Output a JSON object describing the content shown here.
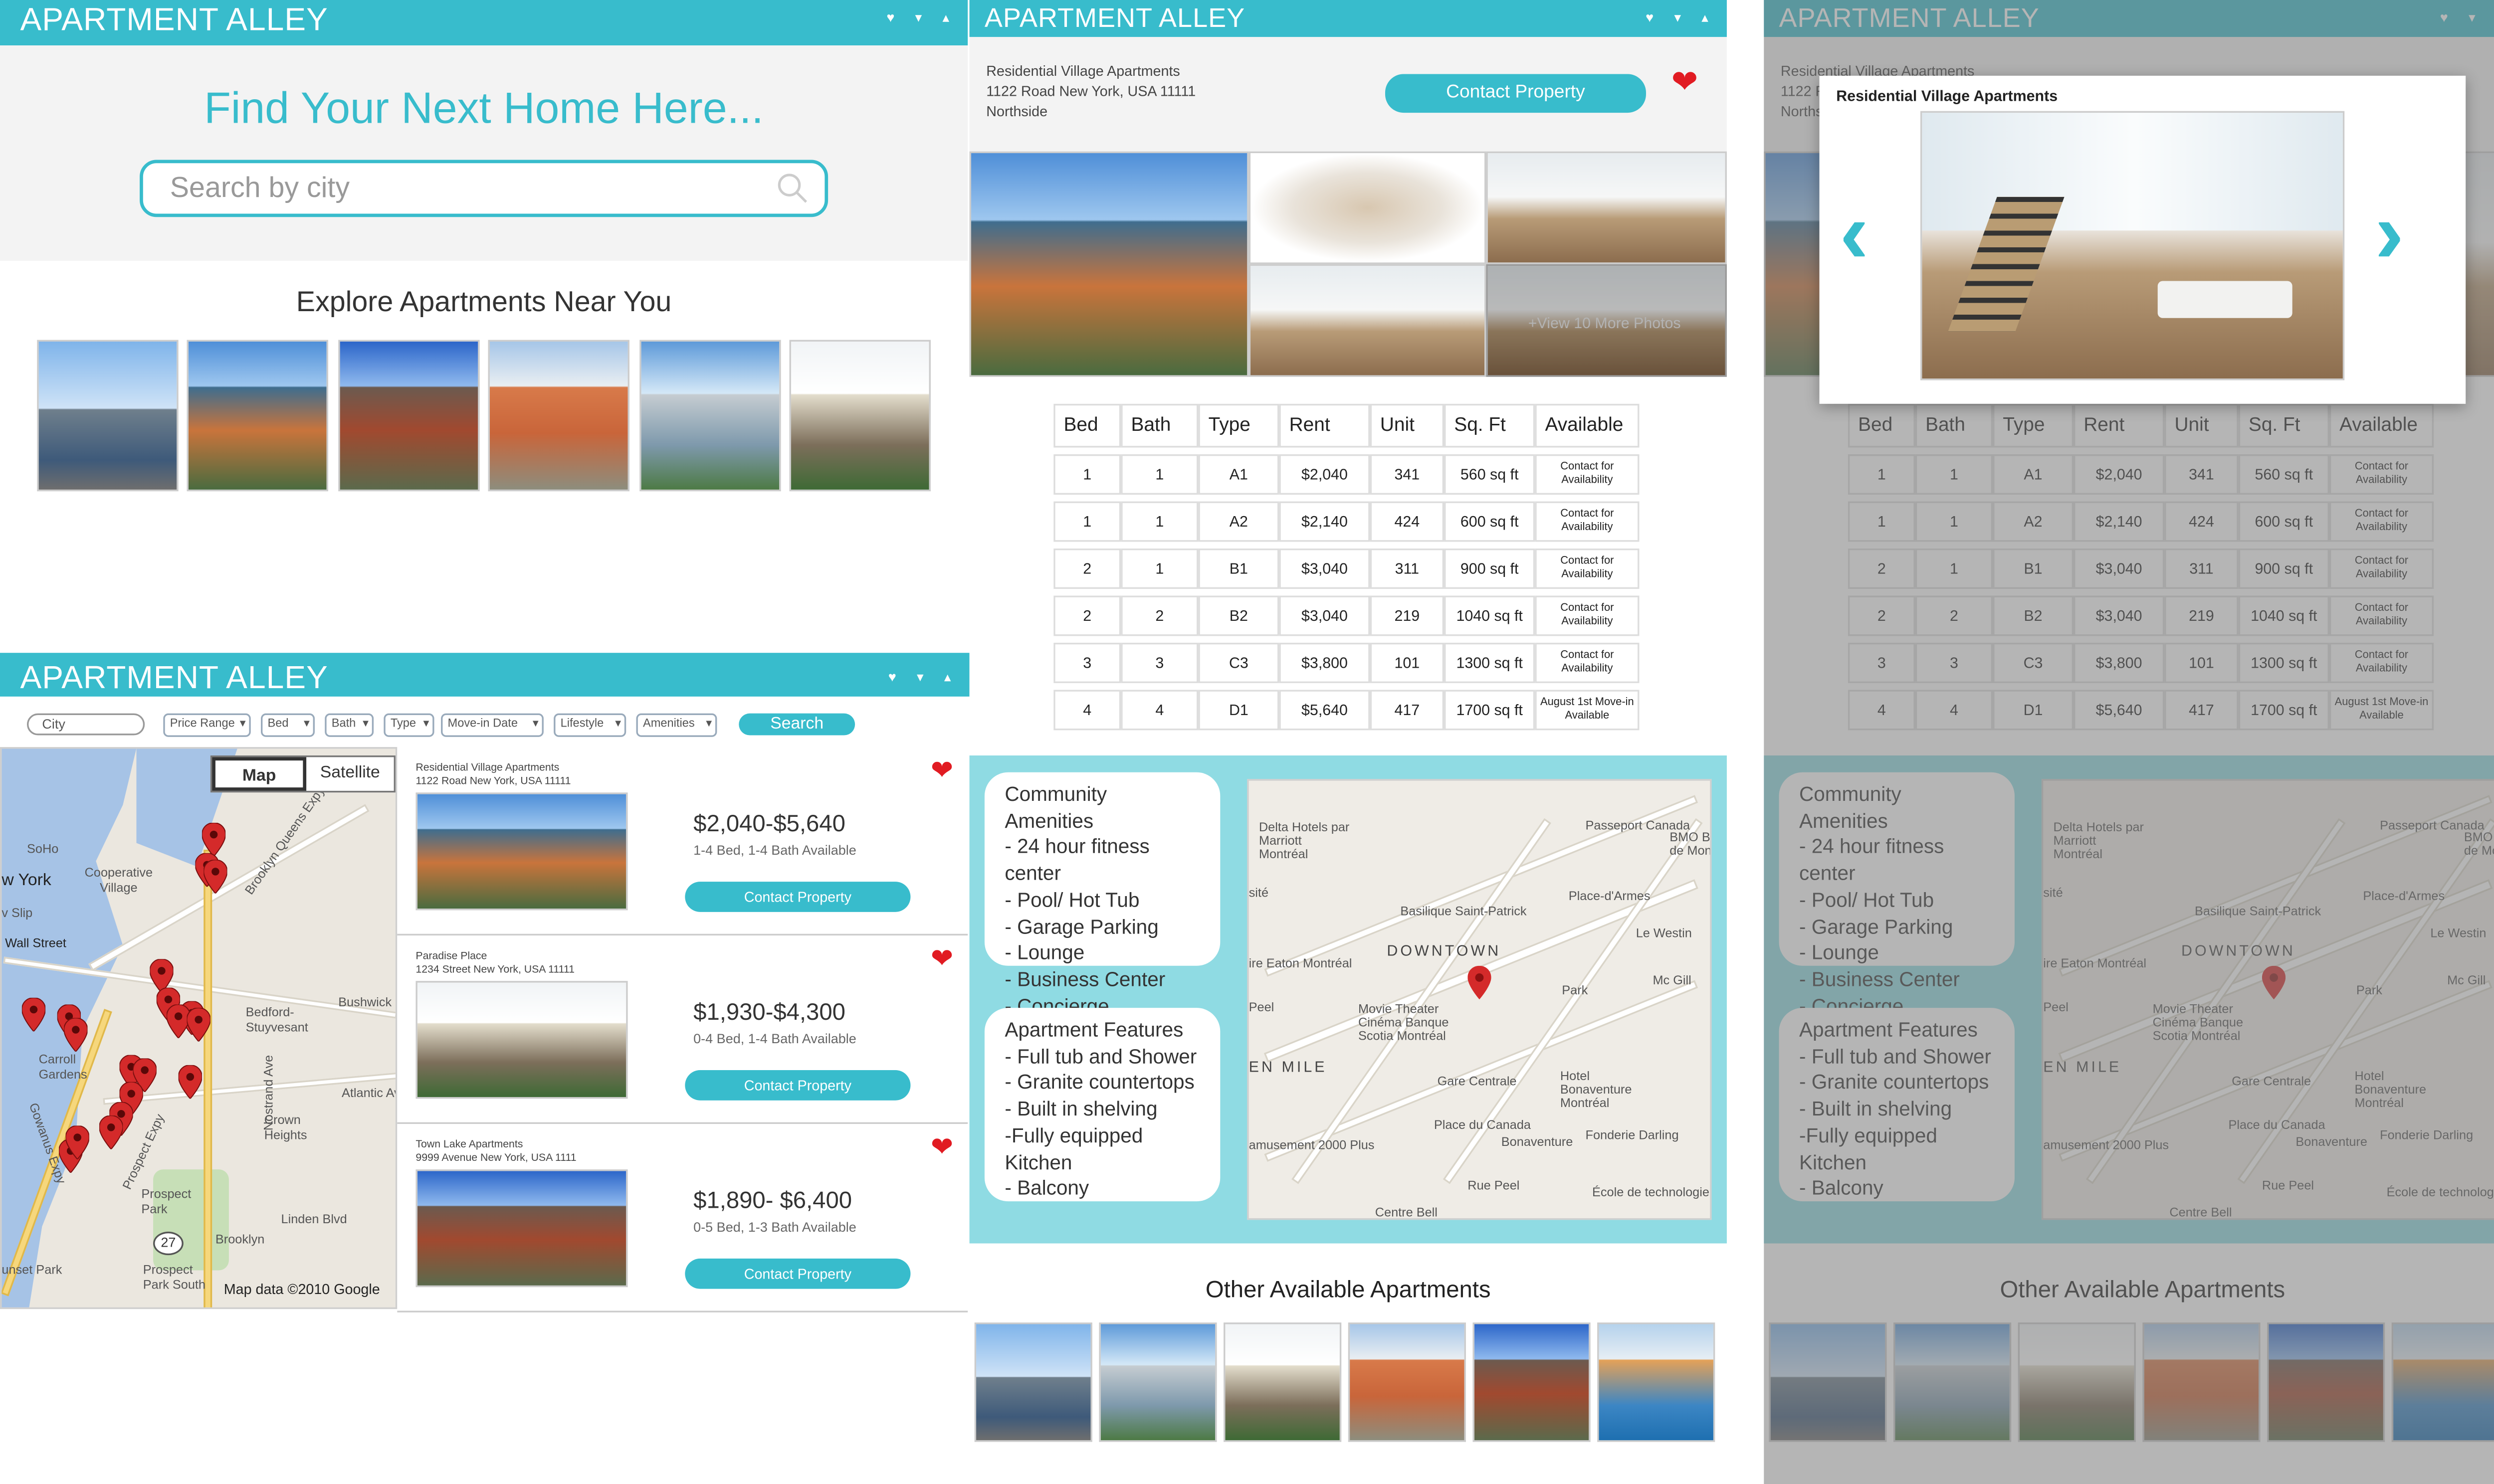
{
  "app_title": "APARTMENT ALLEY",
  "window_controls": "♥ ▾ ▴",
  "home": {
    "headline": "Find Your Next Home Here...",
    "search_placeholder": "Search by city",
    "explore_title": "Explore Apartments Near You"
  },
  "search_screen": {
    "filters": {
      "city_placeholder": "City",
      "price_range": "Price Range",
      "bed": "Bed",
      "bath": "Bath",
      "type": "Type",
      "move_in": "Move-in Date",
      "lifestyle": "Lifestyle",
      "amenities": "Amenities",
      "search_button": "Search"
    },
    "map": {
      "map_tab": "Map",
      "satellite_tab": "Satellite",
      "attribution": "Map data ©2010 Google",
      "labels": [
        "SoHo",
        "w York",
        "Cooperative Village",
        "Wall Street",
        "v Slip",
        "Carroll Gardens",
        "Bedford-Stuyvesant",
        "Bushwick",
        "Crown Heights",
        "Prospect Park",
        "Linden Blvd",
        "Brooklyn",
        "Prospect Park South",
        "unset Park",
        "Atlantic Av",
        "Nostrand Ave",
        "Brooklyn Queens Expy",
        "Prospect Expy",
        "Gowanus Expy",
        "27"
      ]
    },
    "listings": [
      {
        "name": "Residential Village Apartments",
        "address": "1122 Road New York, USA 11111",
        "price": "$2,040-$5,640",
        "details": "1-4 Bed, 1-4 Bath Available",
        "button": "Contact Property"
      },
      {
        "name": "Paradise Place",
        "address": "1234 Street New York, USA 11111",
        "price": "$1,930-$4,300",
        "details": "0-4 Bed, 1-4 Bath Available",
        "button": "Contact Property"
      },
      {
        "name": "Town Lake Apartments",
        "address": "9999 Avenue New York, USA 1111",
        "price": "$1,890- $6,400",
        "details": "0-5 Bed, 1-3 Bath Available",
        "button": "Contact Property"
      }
    ]
  },
  "detail": {
    "name": "Residential Village Apartments",
    "address": "1122 Road New York, USA 11111",
    "neighborhood": "Northside",
    "contact_button": "Contact Property",
    "view_more": "+View 10 More Photos",
    "table": {
      "headers": [
        "Bed",
        "Bath",
        "Type",
        "Rent",
        "Unit",
        "Sq. Ft",
        "Available"
      ],
      "rows": [
        [
          "1",
          "1",
          "A1",
          "$2,040",
          "341",
          "560 sq ft",
          "Contact for Availability"
        ],
        [
          "1",
          "1",
          "A2",
          "$2,140",
          "424",
          "600 sq ft",
          "Contact for Availability"
        ],
        [
          "2",
          "1",
          "B1",
          "$3,040",
          "311",
          "900 sq ft",
          "Contact for Availability"
        ],
        [
          "2",
          "2",
          "B2",
          "$3,040",
          "219",
          "1040 sq ft",
          "Contact for Availability"
        ],
        [
          "3",
          "3",
          "C3",
          "$3,800",
          "101",
          "1300 sq ft",
          "Contact for Availability"
        ],
        [
          "4",
          "4",
          "D1",
          "$5,640",
          "417",
          "1700 sq ft",
          "August 1st Move-in Available"
        ]
      ]
    },
    "amenities": {
      "title": "Community Amenities",
      "items": [
        "- 24 hour fitness center",
        "- Pool/ Hot Tub",
        "- Garage Parking",
        "- Lounge",
        "- Business Center",
        "- Concierge"
      ]
    },
    "features": {
      "title": "Apartment Features",
      "items": [
        "- Full tub and Shower",
        "- Granite countertops",
        "- Built in shelving",
        "-Fully equipped Kitchen",
        "- Balcony"
      ]
    },
    "map_labels": [
      "Delta Hotels par Marriott Montréal",
      "Passeport Canada",
      "Basilique Saint-Patrick",
      "Place-d'Armes",
      "DOWNTOWN",
      "Movie Theater Cinéma Banque Scotia Montréal",
      "Gare Centrale",
      "Hotel Bonaventure Montréal",
      "Place du Canada",
      "Bonaventure",
      "Fonderie Darling",
      "Centre Bell",
      "École de technologie supérieure",
      "Peel",
      "amusement 2000 Plus",
      "ire Eaton Montréal",
      "Park",
      "BMO Banque de Montréal",
      "EN MILE",
      "sité",
      "Rue Peel",
      "Le Westin",
      "Mc Gill"
    ],
    "other_title": "Other Available Apartments"
  },
  "modal": {
    "title": "Residential Village Apartments",
    "prev": "‹",
    "next": "›"
  },
  "colors": {
    "accent": "#38bccc",
    "heart": "#e11b22",
    "teal_panel": "#8fdbe3"
  }
}
